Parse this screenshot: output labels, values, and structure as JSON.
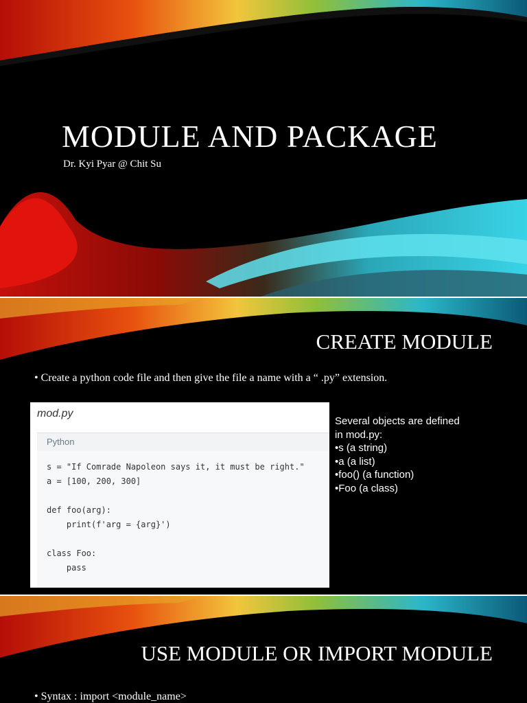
{
  "slides": [
    {
      "title": "MODULE AND PACKAGE",
      "subtitle": "Dr. Kyi Pyar @ Chit Su"
    },
    {
      "title": "CREATE MODULE",
      "bullet": "• Create a python code file  and then give the file a name with a “ .py” extension.",
      "code": {
        "filename": "mod.py",
        "language": "Python",
        "lines": [
          "s = \"If Comrade Napoleon says it, it must be right.\"",
          "a = [100, 200, 300]",
          "",
          "def foo(arg):",
          "    print(f'arg = {arg}')",
          "",
          "class Foo:",
          "    pass"
        ]
      },
      "notes": [
        "Several objects are defined",
        " in mod.py:",
        "•s (a string)",
        "•a (a list)",
        "•foo() (a function)",
        "•Foo (a class)"
      ]
    },
    {
      "title": "USE MODULE OR IMPORT MODULE",
      "bullet": "• Syntax : import <module_name>"
    }
  ],
  "colors": {
    "background": "#000000",
    "text": "#ffffff",
    "accent_red": "#d81a0e",
    "accent_teal": "#27c3d6"
  }
}
